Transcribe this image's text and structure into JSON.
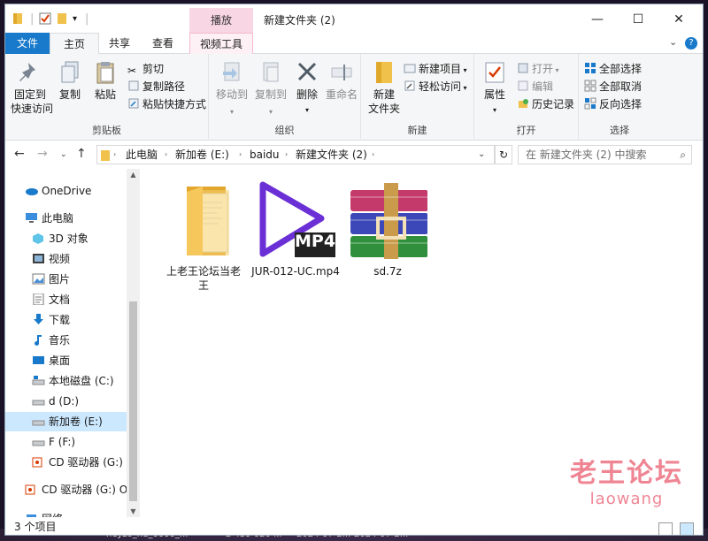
{
  "window": {
    "title": "新建文件夹 (2)",
    "context_tab": "播放",
    "controls": {
      "minimize": "—",
      "maximize": "☐",
      "close": "✕"
    },
    "help": "?"
  },
  "tabs": {
    "file": "文件",
    "home": "主页",
    "share": "共享",
    "view": "查看",
    "video_tools": "视频工具"
  },
  "ribbon": {
    "clipboard": {
      "label": "剪贴板",
      "pin": "固定到\n快速访问",
      "copy": "复制",
      "paste": "粘贴",
      "cut": "剪切",
      "copy_path": "复制路径",
      "paste_shortcut": "粘贴快捷方式"
    },
    "organize": {
      "label": "组织",
      "move_to": "移动到",
      "copy_to": "复制到",
      "delete": "删除",
      "rename": "重命名"
    },
    "new": {
      "label": "新建",
      "new_folder": "新建\n文件夹",
      "new_item": "新建项目",
      "easy_access": "轻松访问"
    },
    "open": {
      "label": "打开",
      "properties": "属性",
      "open": "打开",
      "edit": "编辑",
      "history": "历史记录"
    },
    "select": {
      "label": "选择",
      "select_all": "全部选择",
      "select_none": "全部取消",
      "invert": "反向选择"
    }
  },
  "address": {
    "crumbs": [
      "此电脑",
      "新加卷 (E:)",
      "baidu",
      "新建文件夹 (2)"
    ],
    "search_placeholder": "在 新建文件夹 (2) 中搜索"
  },
  "nav": {
    "items": [
      {
        "label": "OneDrive",
        "icon": "cloud-icon"
      },
      {
        "label": "此电脑",
        "icon": "computer-icon"
      },
      {
        "label": "3D 对象",
        "icon": "cube-icon"
      },
      {
        "label": "视频",
        "icon": "video-icon"
      },
      {
        "label": "图片",
        "icon": "picture-icon"
      },
      {
        "label": "文档",
        "icon": "document-icon"
      },
      {
        "label": "下载",
        "icon": "download-icon"
      },
      {
        "label": "音乐",
        "icon": "music-icon"
      },
      {
        "label": "桌面",
        "icon": "desktop-icon"
      },
      {
        "label": "本地磁盘 (C:)",
        "icon": "drive-c-icon"
      },
      {
        "label": "d (D:)",
        "icon": "drive-icon"
      },
      {
        "label": "新加卷 (E:)",
        "icon": "drive-icon",
        "selected": true
      },
      {
        "label": "F (F:)",
        "icon": "drive-icon"
      },
      {
        "label": "CD 驱动器 (G:) C",
        "icon": "cd-drive-icon"
      },
      {
        "label": "CD 驱动器 (G:) Or",
        "icon": "cd-drive-icon"
      },
      {
        "label": "网络",
        "icon": "network-icon"
      }
    ]
  },
  "files": [
    {
      "name": "上老王论坛当老王",
      "type": "folder",
      "icon": "folder-icon"
    },
    {
      "name": "JUR-012-UC.mp4",
      "type": "mp4",
      "icon": "mp4-icon",
      "badge": "MP4"
    },
    {
      "name": "sd.7z",
      "type": "archive",
      "icon": "winrar-icon"
    }
  ],
  "status": {
    "count": "3 个项目"
  },
  "watermark": {
    "cn": "老王论坛",
    "en": "laowang"
  },
  "background_taskbar": [
    "heyzo_hd_0000_...",
    "2 439 020 ...",
    "2024-07-2...",
    "2024-07-2..."
  ],
  "colors": {
    "accent": "#1979ca",
    "selection": "#cce8ff",
    "context_tab": "#f9d6e4",
    "mp4": "#6b2fd6"
  }
}
